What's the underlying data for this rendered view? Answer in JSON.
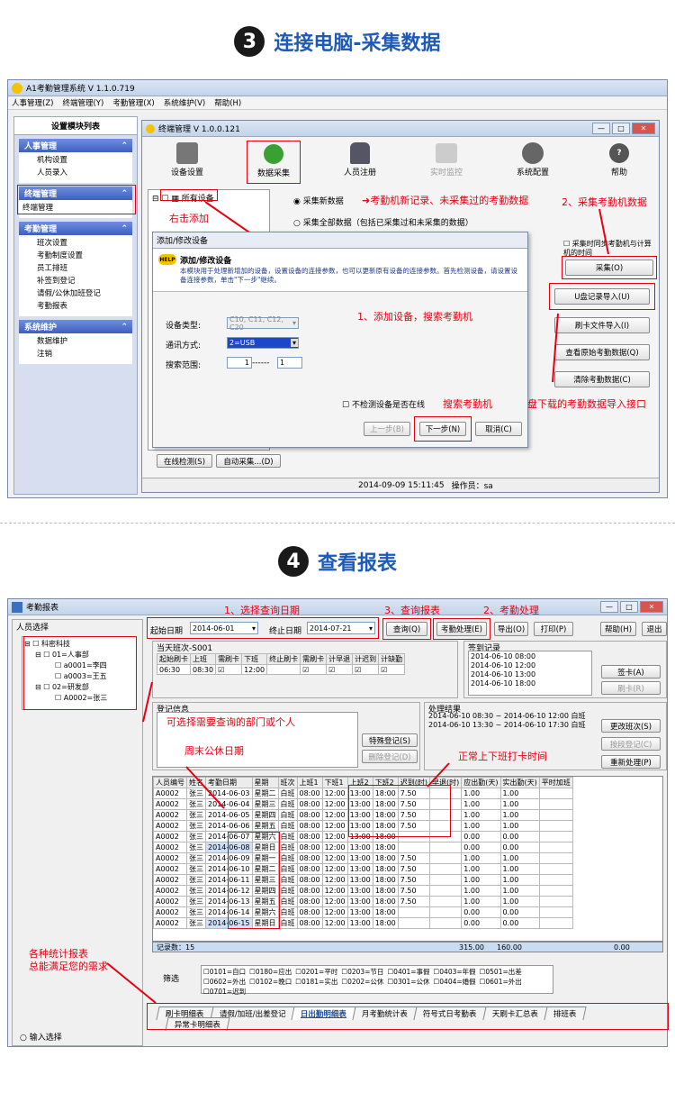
{
  "section1": {
    "num": "3",
    "title": "连接电脑-采集数据"
  },
  "section2": {
    "num": "4",
    "title": "查看报表"
  },
  "app": {
    "title": "A1考勤管理系统 V 1.1.0.719",
    "menu": [
      "人事管理(Z)",
      "终端管理(Y)",
      "考勤管理(X)",
      "系统维护(V)",
      "帮助(H)"
    ],
    "left_title": "设置模块列表",
    "panels": [
      {
        "header": "人事管理",
        "items": [
          "机构设置",
          "人员录入"
        ]
      },
      {
        "header": "终端管理",
        "items": [
          "终端管理"
        ]
      },
      {
        "header": "考勤管理",
        "items": [
          "班次设置",
          "考勤制度设置",
          "员工排班",
          "补签到登记",
          "请假/公休加班登记",
          "考勤报表"
        ]
      },
      {
        "header": "系统维护",
        "items": [
          "数据维护",
          "注销"
        ]
      }
    ]
  },
  "terminal": {
    "title": "终端管理 V 1.0.0.121",
    "toolbar": [
      "设备设置",
      "数据采集",
      "人员注册",
      "实时监控",
      "系统配置",
      "帮助"
    ],
    "tree_root": "所有设备",
    "radio1": "采集新数据",
    "radio2": "采集全部数据（包括已采集过和未采集的数据）",
    "checkbox_sync": "采集时同步考勤机与计算机的时间",
    "buttons": [
      "采集(O)",
      "U盘记录导入(U)",
      "刷卡文件导入(I)",
      "查看原始考勤数据(Q)",
      "清除考勤数据(C)"
    ],
    "bottom_buttons": [
      "在线检测(S)",
      "自动采集...(D)"
    ],
    "status_time": "2014-09-09 15:11:45",
    "status_operator": "操作员：sa"
  },
  "dialog": {
    "title": "添加/修改设备",
    "heading": "添加/修改设备",
    "desc": "本模块用于处理新增加的设备，设置设备的连接参数，也可以更新原有设备的连接参数。首先检测设备，请设置设备连接参数，单击\"下一步\"继续。",
    "help_badge": "HELP",
    "device_type_label": "设备类型:",
    "device_type_value": "C10, C11, C12, C20",
    "comm_label": "通讯方式:",
    "comm_value": "2=USB",
    "range_label": "搜索范围:",
    "range_from": "1",
    "range_dash": "------",
    "range_to": "1",
    "no_detect": "不检测设备是否在线",
    "prev": "上一步(B)",
    "next": "下一步(N)",
    "cancel": "取消(C)"
  },
  "annotations1": {
    "a1": "考勤机新记录、未采集过的考勤数据",
    "a2": "2、采集考勤机数据",
    "a3": "右击添加",
    "a4": "1、添加设备，搜索考勤机",
    "a5": "搜索考勤机",
    "a6": "U盘下载的考勤数据导入接口"
  },
  "report": {
    "title": "考勤报表",
    "people_title": "人员选择",
    "tree": [
      "科密科技",
      "01=人事部",
      "a0001=李四",
      "a0003=王五",
      "02=研发部",
      "A0002=张三"
    ],
    "start_label": "起始日期",
    "start_value": "2014-06-01",
    "end_label": "终止日期",
    "end_value": "2014-07-21",
    "buttons": [
      "查询(Q)",
      "考勤处理(E)",
      "导出(O)",
      "打印(P)",
      "帮助(H)",
      "退出"
    ],
    "shift_title": "当天班次-S001",
    "shift_headers": [
      "起始刷卡",
      "上班",
      "需刷卡",
      "下班",
      "终止刷卡",
      "需刷卡",
      "计早退",
      "计迟到",
      "计缺勤"
    ],
    "shift_row": [
      "06:30",
      "08:30",
      "☑",
      "12:00",
      "",
      "☑",
      "☑",
      "☑",
      "☑"
    ],
    "signin_title": "签到记录",
    "signin_rows": [
      "2014-06-10 08:00",
      "2014-06-10 12:00",
      "2014-06-10 13:00",
      "2014-06-10 18:00"
    ],
    "signin_btns": [
      "签卡(A)",
      "刷卡(R)"
    ],
    "reg_title": "登记信息",
    "reg_btns": [
      "特殊登记(S)",
      "删除登记(D)"
    ],
    "proc_title": "处理结果",
    "proc_rows": [
      "2014-06-10 08:30 ~ 2014-06-10 12:00 白班",
      "2014-06-10 13:30 ~ 2014-06-10 17:30 白班"
    ],
    "proc_btns": [
      "更改班次(S)",
      "按段登记(C)",
      "重新处理(P)"
    ],
    "headers": [
      "人员编号",
      "姓名",
      "考勤日期",
      "星期",
      "班次",
      "上班1",
      "下班1",
      "上班2",
      "下班2",
      "迟到(时)",
      "早退(时)",
      "应出勤(天)",
      "实出勤(天)",
      "平时加班"
    ],
    "rows": [
      [
        "A0002",
        "张三",
        "2014-06-03",
        "星期二",
        "白班",
        "08:00",
        "12:00",
        "13:00",
        "18:00",
        "7.50",
        "",
        "1.00",
        "1.00",
        ""
      ],
      [
        "A0002",
        "张三",
        "2014-06-04",
        "星期三",
        "白班",
        "08:00",
        "12:00",
        "13:00",
        "18:00",
        "7.50",
        "",
        "1.00",
        "1.00",
        ""
      ],
      [
        "A0002",
        "张三",
        "2014-06-05",
        "星期四",
        "白班",
        "08:00",
        "12:00",
        "13:00",
        "18:00",
        "7.50",
        "",
        "1.00",
        "1.00",
        ""
      ],
      [
        "A0002",
        "张三",
        "2014-06-06",
        "星期五",
        "白班",
        "08:00",
        "12:00",
        "13:00",
        "18:00",
        "7.50",
        "",
        "1.00",
        "1.00",
        ""
      ],
      [
        "A0002",
        "张三",
        "2014-06-07",
        "星期六",
        "白班",
        "08:00",
        "12:00",
        "13:00",
        "18:00",
        "",
        "",
        "0.00",
        "0.00",
        ""
      ],
      [
        "A0002",
        "张三",
        "2014-06-08",
        "星期日",
        "白班",
        "08:00",
        "12:00",
        "13:00",
        "18:00",
        "",
        "",
        "0.00",
        "0.00",
        ""
      ],
      [
        "A0002",
        "张三",
        "2014-06-09",
        "星期一",
        "白班",
        "08:00",
        "12:00",
        "13:00",
        "18:00",
        "7.50",
        "",
        "1.00",
        "1.00",
        ""
      ],
      [
        "A0002",
        "张三",
        "2014-06-10",
        "星期二",
        "白班",
        "08:00",
        "12:00",
        "13:00",
        "18:00",
        "7.50",
        "",
        "1.00",
        "1.00",
        ""
      ],
      [
        "A0002",
        "张三",
        "2014-06-11",
        "星期三",
        "白班",
        "08:00",
        "12:00",
        "13:00",
        "18:00",
        "7.50",
        "",
        "1.00",
        "1.00",
        ""
      ],
      [
        "A0002",
        "张三",
        "2014-06-12",
        "星期四",
        "白班",
        "08:00",
        "12:00",
        "13:00",
        "18:00",
        "7.50",
        "",
        "1.00",
        "1.00",
        ""
      ],
      [
        "A0002",
        "张三",
        "2014-06-13",
        "星期五",
        "白班",
        "08:00",
        "12:00",
        "13:00",
        "18:00",
        "7.50",
        "",
        "1.00",
        "1.00",
        ""
      ],
      [
        "A0002",
        "张三",
        "2014-06-14",
        "星期六",
        "白班",
        "08:00",
        "12:00",
        "13:00",
        "18:00",
        "",
        "",
        "0.00",
        "0.00",
        ""
      ],
      [
        "A0002",
        "张三",
        "2014-06-15",
        "星期日",
        "白班",
        "08:00",
        "12:00",
        "13:00",
        "18:00",
        "",
        "",
        "0.00",
        "0.00",
        ""
      ]
    ],
    "footer_label": "记录数：15",
    "footer_vals": [
      "315.00",
      "160.00",
      "0.00"
    ],
    "filter_label": "筛选",
    "filters": [
      "0101=自口",
      "0180=应出",
      "0201=平时",
      "0203=节日",
      "0401=事假",
      "0403=年假",
      "0501=出差",
      "0602=外出",
      "0102=晚口",
      "0181=实出",
      "0202=公休",
      "0301=公休",
      "0404=婚假",
      "0601=外出",
      "0701=迟到"
    ],
    "input_select": "输入选择",
    "tabs": [
      "刷卡明细表",
      "请假/加班/出差登记",
      "日出勤明细表",
      "月考勤统计表",
      "符号式日考勤表",
      "天刷卡汇总表",
      "排班表",
      "异常卡明细表"
    ]
  },
  "annotations2": {
    "b1": "1、选择查询日期",
    "b2": "3、查询报表",
    "b3": "2、考勤处理",
    "b4": "可选择需要查询的部门或个人",
    "b5": "周末公休日期",
    "b6": "正常上下班打卡时间",
    "b7": "各种统计报表",
    "b8": "总能满足您的需求"
  }
}
